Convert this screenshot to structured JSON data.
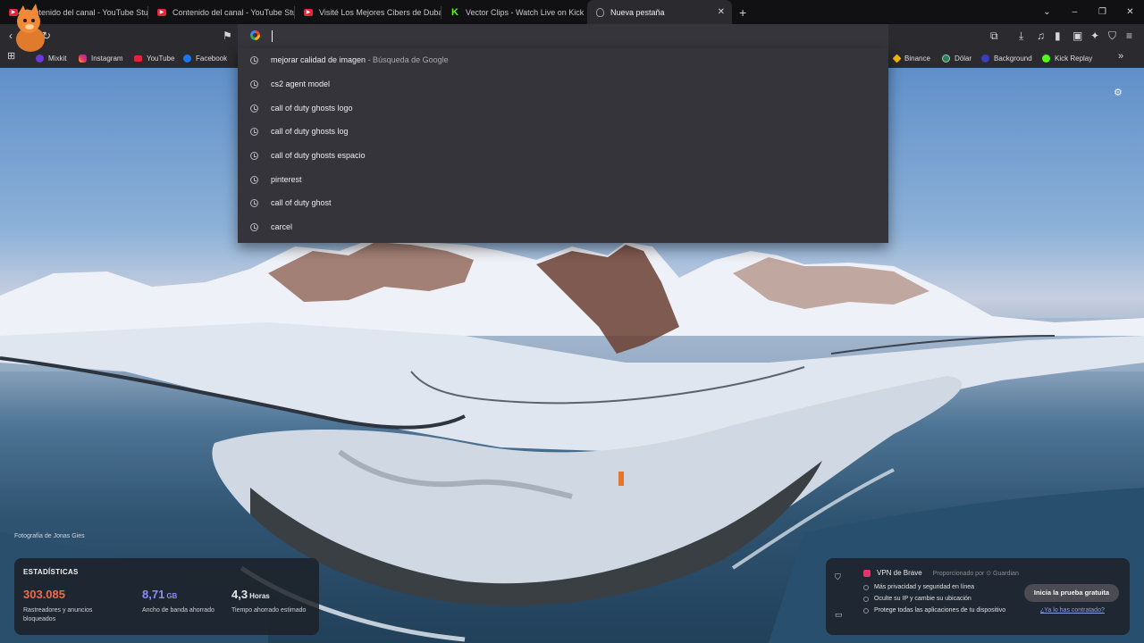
{
  "tabs": [
    {
      "label": "Contenido del canal - YouTube Studio",
      "icon": "youtube-icon"
    },
    {
      "label": "Contenido del canal - YouTube Studio",
      "icon": "youtube-icon"
    },
    {
      "label": "Visité Los Mejores Cibers de Dubai -",
      "icon": "youtube-icon"
    },
    {
      "label": "Vector Clips - Watch Live on Kick",
      "icon": "kick-icon"
    },
    {
      "label": "Nueva pestaña",
      "icon": "brave-icon",
      "active": true
    }
  ],
  "tab_close": "✕",
  "new_tab": "+",
  "window_controls": {
    "dropdown": "⌄",
    "minimize": "–",
    "restore": "❐",
    "close": "✕"
  },
  "bookmarks": {
    "left": [
      {
        "label": "Mixkit",
        "icon": "mixkit-icon"
      },
      {
        "label": "Instagram",
        "icon": "instagram-icon"
      },
      {
        "label": "YouTube",
        "icon": "youtube-icon"
      },
      {
        "label": "Facebook",
        "icon": "facebook-icon"
      }
    ],
    "right": [
      {
        "label": "Binance",
        "icon": "binance-icon"
      },
      {
        "label": "Dólar",
        "icon": "dolar-icon"
      },
      {
        "label": "Background",
        "icon": "background-icon"
      },
      {
        "label": "Kick Replay",
        "icon": "kick-replay-icon"
      }
    ],
    "overflow": "»"
  },
  "omnibox": {
    "value": ""
  },
  "suggestions": [
    {
      "text": "mejorar calidad de imagen",
      "sub": " - Búsqueda de Google"
    },
    {
      "text": "cs2 agent model",
      "sub": ""
    },
    {
      "text": "call of duty ghosts logo",
      "sub": ""
    },
    {
      "text": "call of duty ghosts log",
      "sub": ""
    },
    {
      "text": "call of duty ghosts espacio",
      "sub": ""
    },
    {
      "text": "pinterest",
      "sub": ""
    },
    {
      "text": "call of duty ghost",
      "sub": ""
    },
    {
      "text": "carcel",
      "sub": ""
    }
  ],
  "photo_credit": "Fotografía de Jonas Gies",
  "stats": {
    "title": "ESTADÍSTICAS",
    "items": [
      {
        "value": "303.085",
        "unit": "",
        "label": "Rastreadores y anuncios bloqueados",
        "color": "#f06a4a"
      },
      {
        "value": "8,71",
        "unit": "GB",
        "label": "Ancho de banda ahorrado",
        "color": "#8a8ff5"
      },
      {
        "value": "4,3",
        "unit": "Horas",
        "label": "Tiempo ahorrado estimado",
        "color": "#ffffff"
      }
    ]
  },
  "vpn": {
    "title": "VPN de Brave",
    "provider": "Proporcionado por ⊙ Guardian",
    "features": [
      "Más privacidad y seguridad en línea",
      "Oculte su IP y cambie su ubicación",
      "Protege todas las aplicaciones de tu dispositivo"
    ],
    "cta": "Inicia la prueba gratuita",
    "link": "¿Ya lo has contratado?"
  },
  "colors": {
    "accent_orange": "#f06a4a",
    "accent_purple": "#8a8ff5",
    "kick_green": "#53fc18"
  }
}
